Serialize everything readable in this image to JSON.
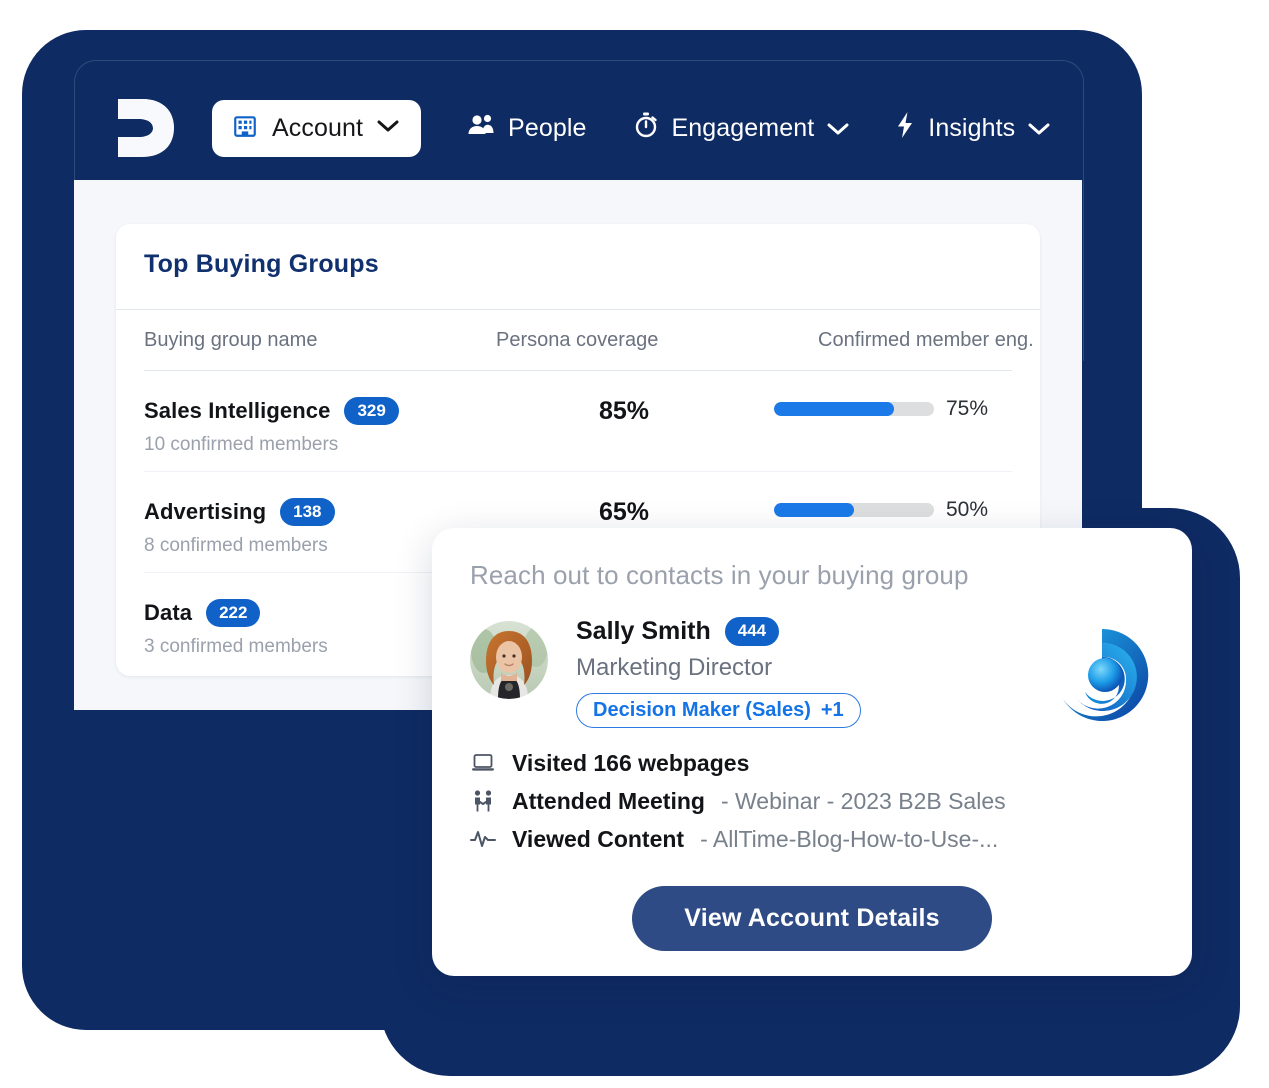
{
  "colors": {
    "frame_navy": "#0F2B63",
    "board_bg": "#F5F7FA",
    "badge_blue": "#1062C8",
    "progress_blue": "#1B7AE8",
    "progress_track": "#DDDEDF",
    "cta_blue": "#2F4B85",
    "persona_blue": "#1473E6",
    "title_navy": "#11306E"
  },
  "nav": {
    "logo": "d-logo",
    "account": {
      "label": "Account",
      "icon": "building-icon",
      "chevron": "chevron-down-icon"
    },
    "items": [
      {
        "label": "People",
        "icon": "people-icon",
        "has_chevron": false
      },
      {
        "label": "Engagement",
        "icon": "stopwatch-icon",
        "has_chevron": true
      },
      {
        "label": "Insights",
        "icon": "lightning-bolt-icon",
        "has_chevron": true
      }
    ]
  },
  "panel": {
    "title": "Top Buying Groups",
    "columns": [
      "Buying group name",
      "Persona coverage",
      "Confirmed member eng."
    ],
    "rows": [
      {
        "name": "Sales Intelligence",
        "badge": "329",
        "members": "10 confirmed members",
        "coverage": "85%",
        "engagement": "75%",
        "engagement_value": 75
      },
      {
        "name": "Advertising",
        "badge": "138",
        "members": "8 confirmed members",
        "coverage": "65%",
        "engagement": "50%",
        "engagement_value": 50
      },
      {
        "name": "Data",
        "badge": "222",
        "members": "3 confirmed members",
        "coverage": "",
        "engagement": "",
        "engagement_value": 0
      }
    ]
  },
  "popup": {
    "title": "Reach out to contacts in your buying group",
    "avatar": "person-photo-avatar",
    "company_logo": "company-swirl-logo",
    "contact": {
      "name": "Sally Smith",
      "badge": "444",
      "job_title": "Marketing Director",
      "persona": "Decision Maker (Sales)",
      "persona_more": "+1"
    },
    "activities": [
      {
        "icon": "laptop-icon",
        "label": "Visited 166 webpages",
        "value": ""
      },
      {
        "icon": "handshake-people-icon",
        "label": "Attended Meeting",
        "value": "- Webinar - 2023 B2B Sales"
      },
      {
        "icon": "pulse-wave-icon",
        "label": "Viewed Content",
        "value": "- AllTime-Blog-How-to-Use-..."
      }
    ],
    "cta": "View Account Details"
  }
}
